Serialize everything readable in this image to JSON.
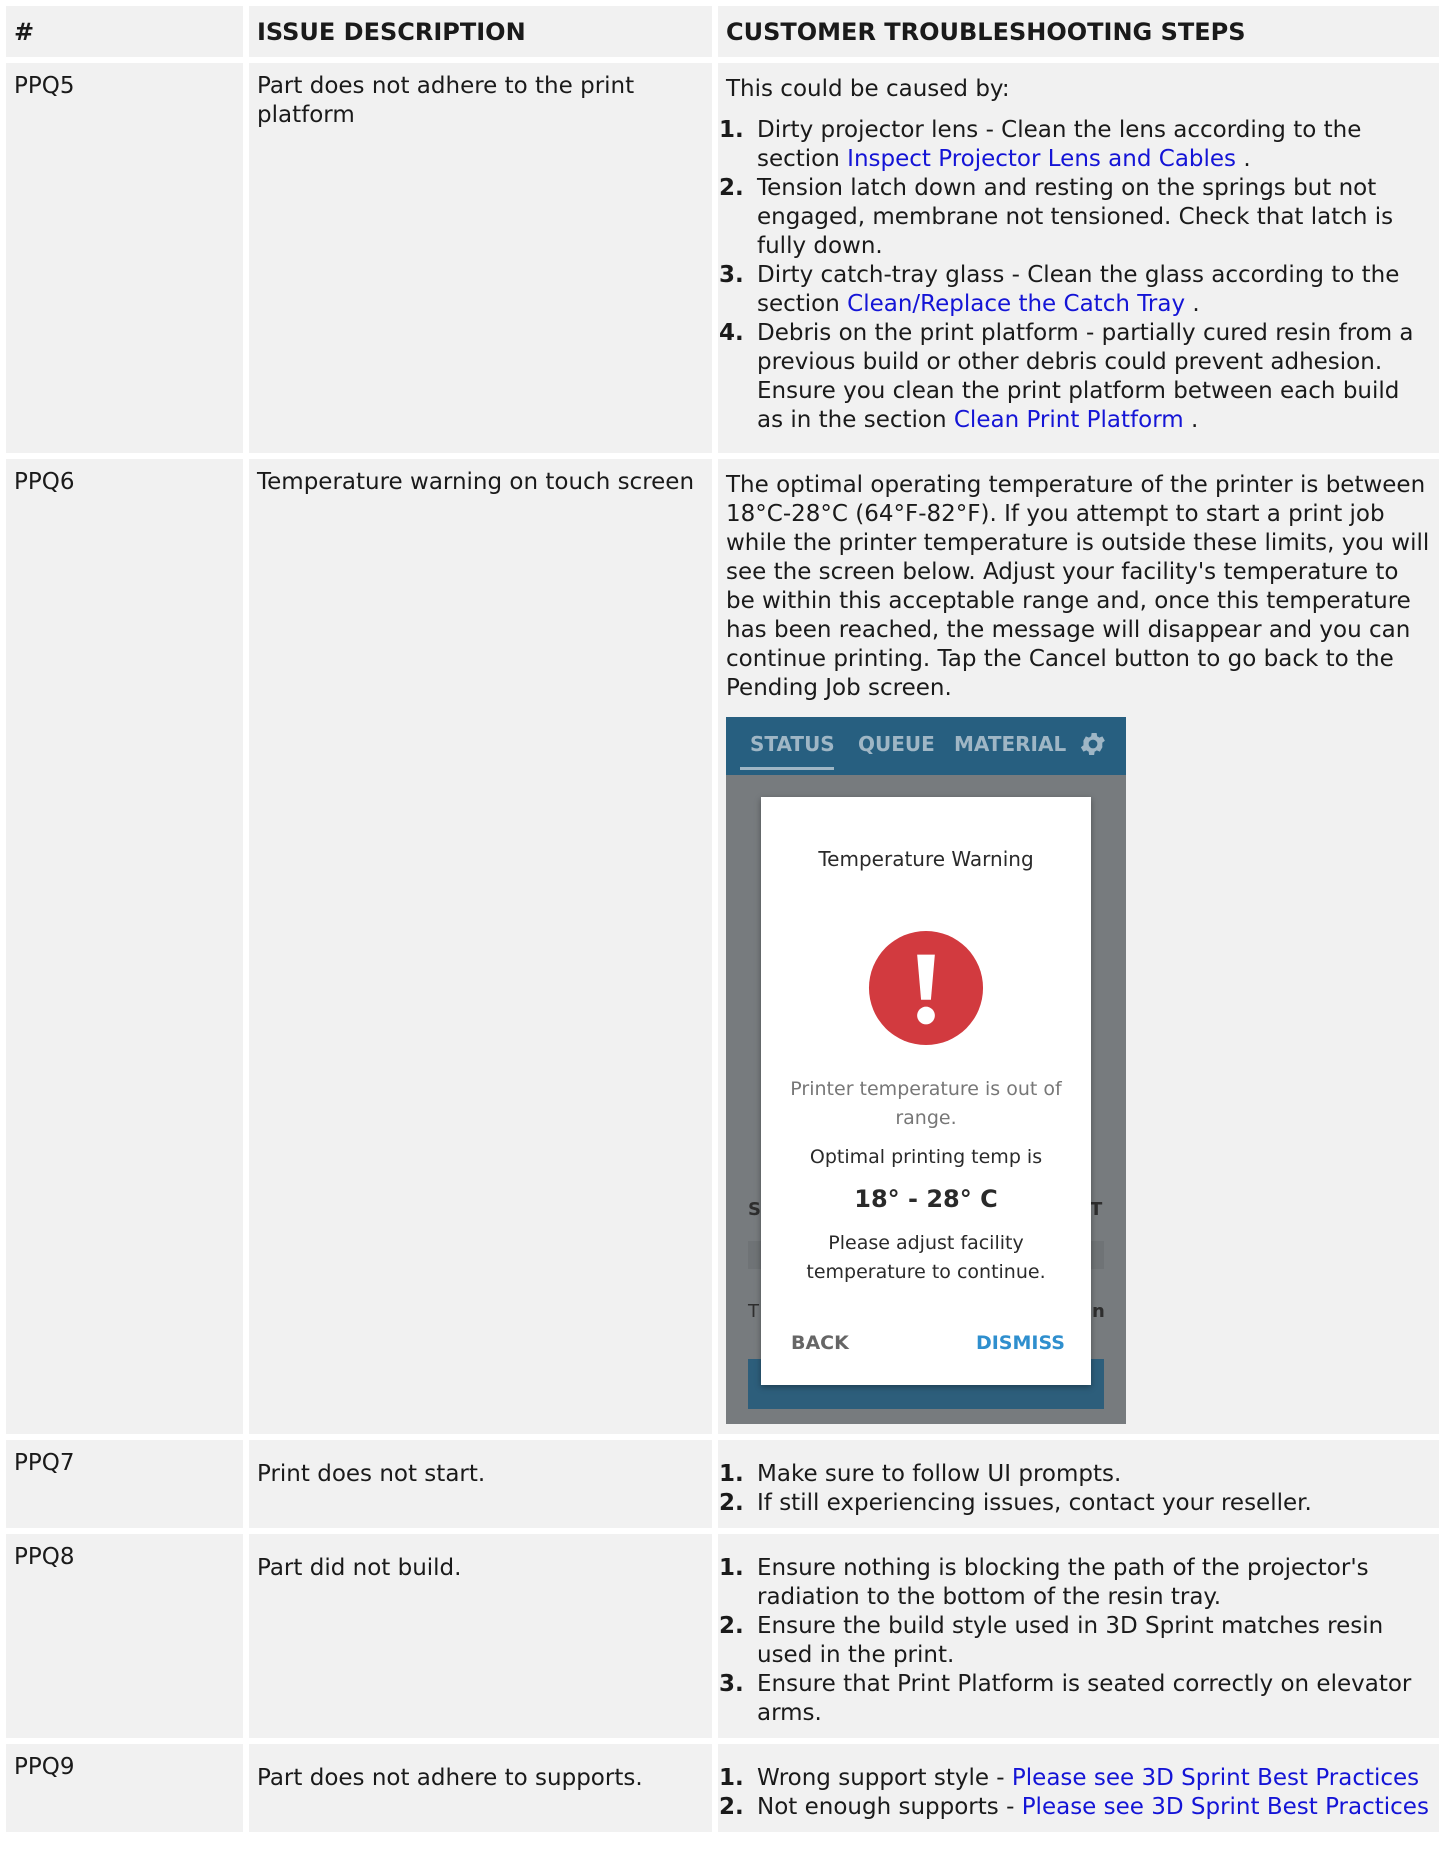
{
  "headers": [
    "#",
    "ISSUE DESCRIPTION",
    "CUSTOMER TROUBLESHOOTING STEPS"
  ],
  "rows": [
    {
      "id": "PPQ5",
      "issue": "Part does not adhere to the print platform",
      "intro": "This could be caused by:",
      "steps": [
        {
          "num": "1.",
          "text": "Dirty projector lens - Clean the lens according to the section ",
          "link": "Inspect Projector Lens and Cables",
          "after": " ."
        },
        {
          "num": "2.",
          "text": "Tension latch down and resting on the springs but not engaged, membrane not tensioned. Check that latch is fully down.",
          "link": "",
          "after": ""
        },
        {
          "num": "3.",
          "text": "Dirty catch-tray glass - Clean the glass according to the section ",
          "link": "Clean/Replace the Catch Tray",
          "after": " ."
        },
        {
          "num": "4.",
          "text": "Debris on the print platform - partially cured resin from a previous build or other debris could prevent adhesion. Ensure you clean the print platform between each build as in the section ",
          "link": "Clean Print Platform",
          "after": " ."
        }
      ]
    },
    {
      "id": "PPQ6",
      "issue": "Temperature warning on touch screen",
      "paragraph": "The optimal operating temperature of the printer is between 18°C-28°C (64°F-82°F). If you attempt to start a print job while the printer temperature is outside these limits, you will see the screen below. Adjust your facility's temperature to be within this acceptable range and, once this temperature has been reached, the message will disappear and you can continue printing. Tap the Cancel button to go back to the Pending Job screen.",
      "screenshot": {
        "tabs": [
          "STATUS",
          "QUEUE",
          "MATERIAL"
        ],
        "settings_icon": "gear-icon",
        "bg_left_s": "S",
        "bg_right_t": "T",
        "bg_left_t": "T",
        "bg_right_n": "n",
        "dialog": {
          "title": "Temperature Warning",
          "icon": "exclamation-circle-icon",
          "icon_color": "#d23a3f",
          "message": "Printer temperature is out of range.",
          "optimal_label": "Optimal printing temp is",
          "range": "18° - 28° C",
          "adjust": "Please adjust facility temperature to continue.",
          "back_label": "BACK",
          "dismiss_label": "DISMISS"
        }
      }
    },
    {
      "id": "PPQ7",
      "issue": "Print does not start.",
      "steps": [
        {
          "num": "1.",
          "text": "Make sure to follow UI prompts.",
          "link": "",
          "after": ""
        },
        {
          "num": "2.",
          "text": "If still experiencing issues, contact your reseller.",
          "link": "",
          "after": ""
        }
      ]
    },
    {
      "id": "PPQ8",
      "issue": "Part did not build.",
      "steps": [
        {
          "num": "1.",
          "text": "Ensure nothing is blocking the path of the projector's radiation to the bottom of the resin tray.",
          "link": "",
          "after": ""
        },
        {
          "num": "2.",
          "text": "Ensure the build style used in 3D Sprint matches resin used in the print.",
          "link": "",
          "after": ""
        },
        {
          "num": "3.",
          "text": "Ensure that Print Platform is seated correctly on elevator arms.",
          "link": "",
          "after": ""
        }
      ]
    },
    {
      "id": "PPQ9",
      "issue": "Part does not adhere to supports.",
      "steps": [
        {
          "num": "1.",
          "text": "Wrong support style - ",
          "link": "Please see 3D Sprint Best Practices",
          "after": ""
        },
        {
          "num": "2.",
          "text": "Not enough supports - ",
          "link": "Please see 3D Sprint Best Practices",
          "after": ""
        }
      ]
    }
  ],
  "colors": {
    "cell_bg": "#f1f1f1",
    "link": "#1414d6",
    "topbar": "#275f80",
    "dismiss": "#2f8fce"
  }
}
